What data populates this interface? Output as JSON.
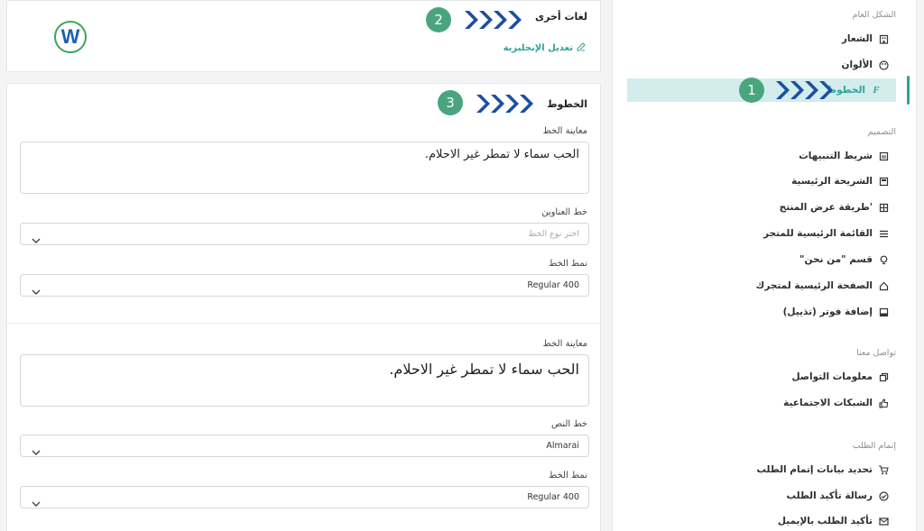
{
  "sidebar": {
    "sections": [
      {
        "title": "الشكل العام"
      },
      {
        "title": "التصميم"
      },
      {
        "title": "تواصل معنا"
      },
      {
        "title": "إتمام الطلب"
      }
    ],
    "items": [
      {
        "label": "الشعار",
        "icon": "building-icon"
      },
      {
        "label": "الألوان",
        "icon": "palette-icon"
      },
      {
        "label": "الخطوط",
        "icon": "font-icon",
        "active": true
      },
      {
        "label": "شريط التنبيهات",
        "icon": "alert-bar-icon"
      },
      {
        "label": "الشريحة الرئيسية",
        "icon": "slider-icon"
      },
      {
        "label": "'طريقة عرض المنتج",
        "icon": "grid-icon"
      },
      {
        "label": "القائمة الرئيسية للمتجر",
        "icon": "menu-icon"
      },
      {
        "label": "قسم \"من نحن\"",
        "icon": "bulb-icon"
      },
      {
        "label": "الصفحة الرئيسية لمتجرك",
        "icon": "home-icon"
      },
      {
        "label": "إضافة فوتر (تذييل)",
        "icon": "footer-icon"
      },
      {
        "label": "معلومات التواصل",
        "icon": "contact-icon"
      },
      {
        "label": "الشبكات الاجتماعية",
        "icon": "thumbs-up-icon"
      },
      {
        "label": "تحديد بيانات إتمام الطلب",
        "icon": "cart-icon"
      },
      {
        "label": "رسالة تأكيد الطلب",
        "icon": "check-circle-icon"
      },
      {
        "label": "تأكيد الطلب بالإيميل",
        "icon": "mail-icon"
      }
    ]
  },
  "badges": [
    "1",
    "2",
    "3"
  ],
  "other_languages": {
    "title": "لغات أخرى",
    "edit_link": "تعديل الإنجليزية",
    "logo_letter": "W"
  },
  "fonts": {
    "title": "الخطوط",
    "preview_label_1": "معاينة الخط",
    "preview_text_1": "الحب سماء لا تمطر غير الاحلام.",
    "headings_font_label": "خط العناوين",
    "headings_font_placeholder": "اختر نوع الخط",
    "font_style_label_1": "نمط الخط",
    "font_style_value_1": "Regular 400",
    "preview_label_2": "معاينة الخط",
    "preview_text_2": "الحب سماء لا تمطر غير الاحلام.",
    "text_font_label": "خط النص",
    "text_font_value": "Almarai",
    "font_style_label_2": "نمط الخط",
    "font_style_value_2": "Regular 400"
  },
  "colors": {
    "accent": "#2fa397",
    "badge": "#48a57d",
    "chevron": "#1b4fa0",
    "active_bg": "#d3ecec"
  }
}
